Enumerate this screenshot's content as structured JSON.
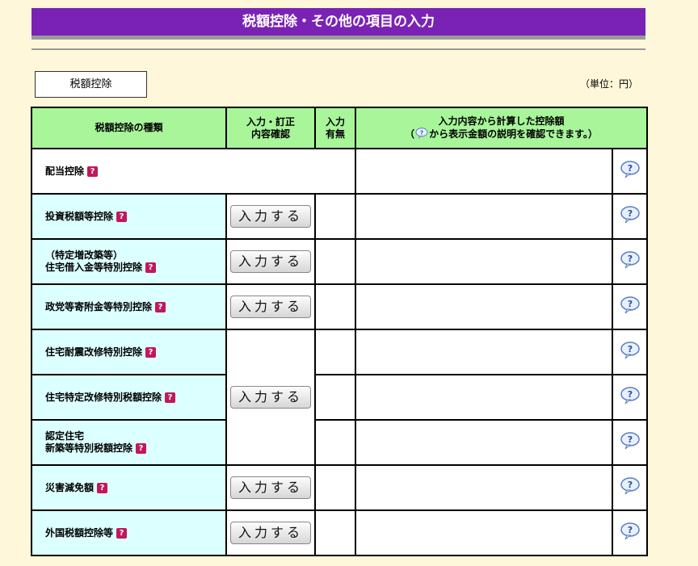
{
  "page": {
    "title": "税額控除・その他の項目の入力",
    "section_label": "税額控除",
    "unit_note": "（単位：円）"
  },
  "table": {
    "headers": {
      "type": "税額控除の種類",
      "confirm_line1": "入力・訂正",
      "confirm_line2": "内容確認",
      "present_line1": "入力",
      "present_line2": "有無",
      "calc_line1": "入力内容から計算した控除額",
      "calc_line2_pre": "（",
      "calc_line2_post": "から表示金額の説明を確認できます。）"
    },
    "input_button_label": "入力する",
    "help_badge": "?",
    "rows": [
      {
        "label": "配当控除"
      },
      {
        "label": "投資税額等控除"
      },
      {
        "label_line1": "（特定増改築等）",
        "label_line2": "住宅借入金等特別控除"
      },
      {
        "label": "政党等寄附金等特別控除"
      },
      {
        "label": "住宅耐震改修特別控除"
      },
      {
        "label": "住宅特定改修特別税額控除"
      },
      {
        "label_line1": "認定住宅",
        "label_line2": "新築等特別税額控除"
      },
      {
        "label": "災害減免額"
      },
      {
        "label": "外国税額控除等"
      }
    ]
  },
  "icons": {
    "help": "speech-bubble-question-icon",
    "badge": "question-badge-icon"
  },
  "colors": {
    "banner": "#7a22b6",
    "header_green": "#a8f59a",
    "label_cyan": "#dcffff",
    "badge_red": "#c2185b",
    "background": "#fff7d9"
  }
}
